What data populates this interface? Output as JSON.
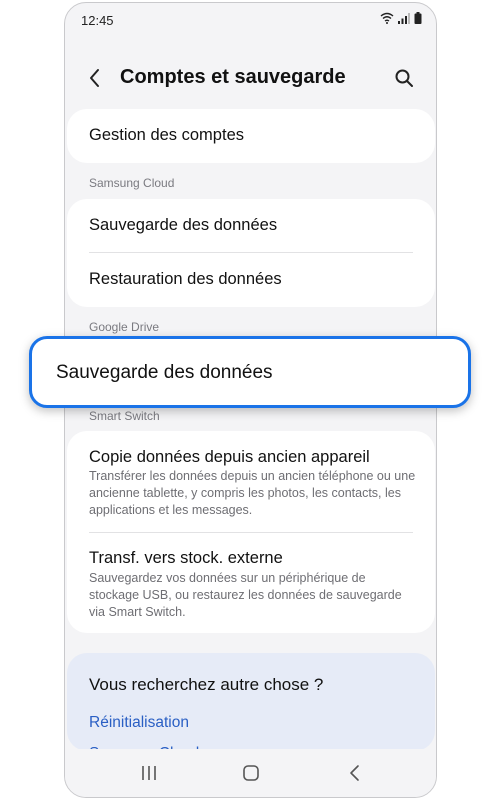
{
  "status_bar": {
    "time": "12:45",
    "icons": [
      "wifi-icon",
      "signal-icon",
      "battery-icon"
    ]
  },
  "header": {
    "title": "Comptes et sauvegarde",
    "back_icon": "chevron-left-icon",
    "search_icon": "search-icon"
  },
  "accounts": {
    "manage_label": "Gestion des comptes"
  },
  "samsung_cloud": {
    "section_label": "Samsung Cloud",
    "backup_label": "Sauvegarde des données",
    "restore_label": "Restauration des données"
  },
  "google_drive": {
    "section_label": "Google Drive",
    "backup_label": "Sauvegarde des données"
  },
  "smart_switch": {
    "section_label": "Smart Switch",
    "items": [
      {
        "title": "Copie données depuis ancien appareil",
        "description": "Transférer les données depuis un ancien téléphone ou une ancienne tablette, y compris les photos, les contacts, les applications et les messages."
      },
      {
        "title": "Transf. vers stock. externe",
        "description": "Sauvegardez vos données sur un périphérique de stockage USB, ou restaurez les données de sauvegarde via Smart Switch."
      }
    ]
  },
  "help": {
    "title": "Vous recherchez autre chose ?",
    "links": [
      "Réinitialisation",
      "Samsung Cloud"
    ]
  },
  "nav_bar": {
    "icons": [
      "recent-apps-icon",
      "home-icon",
      "back-icon"
    ]
  },
  "colors": {
    "accent": "#1a73e8",
    "link": "#2a5fc4",
    "background": "#f4f4f6",
    "help_background": "#e6ebf7"
  }
}
